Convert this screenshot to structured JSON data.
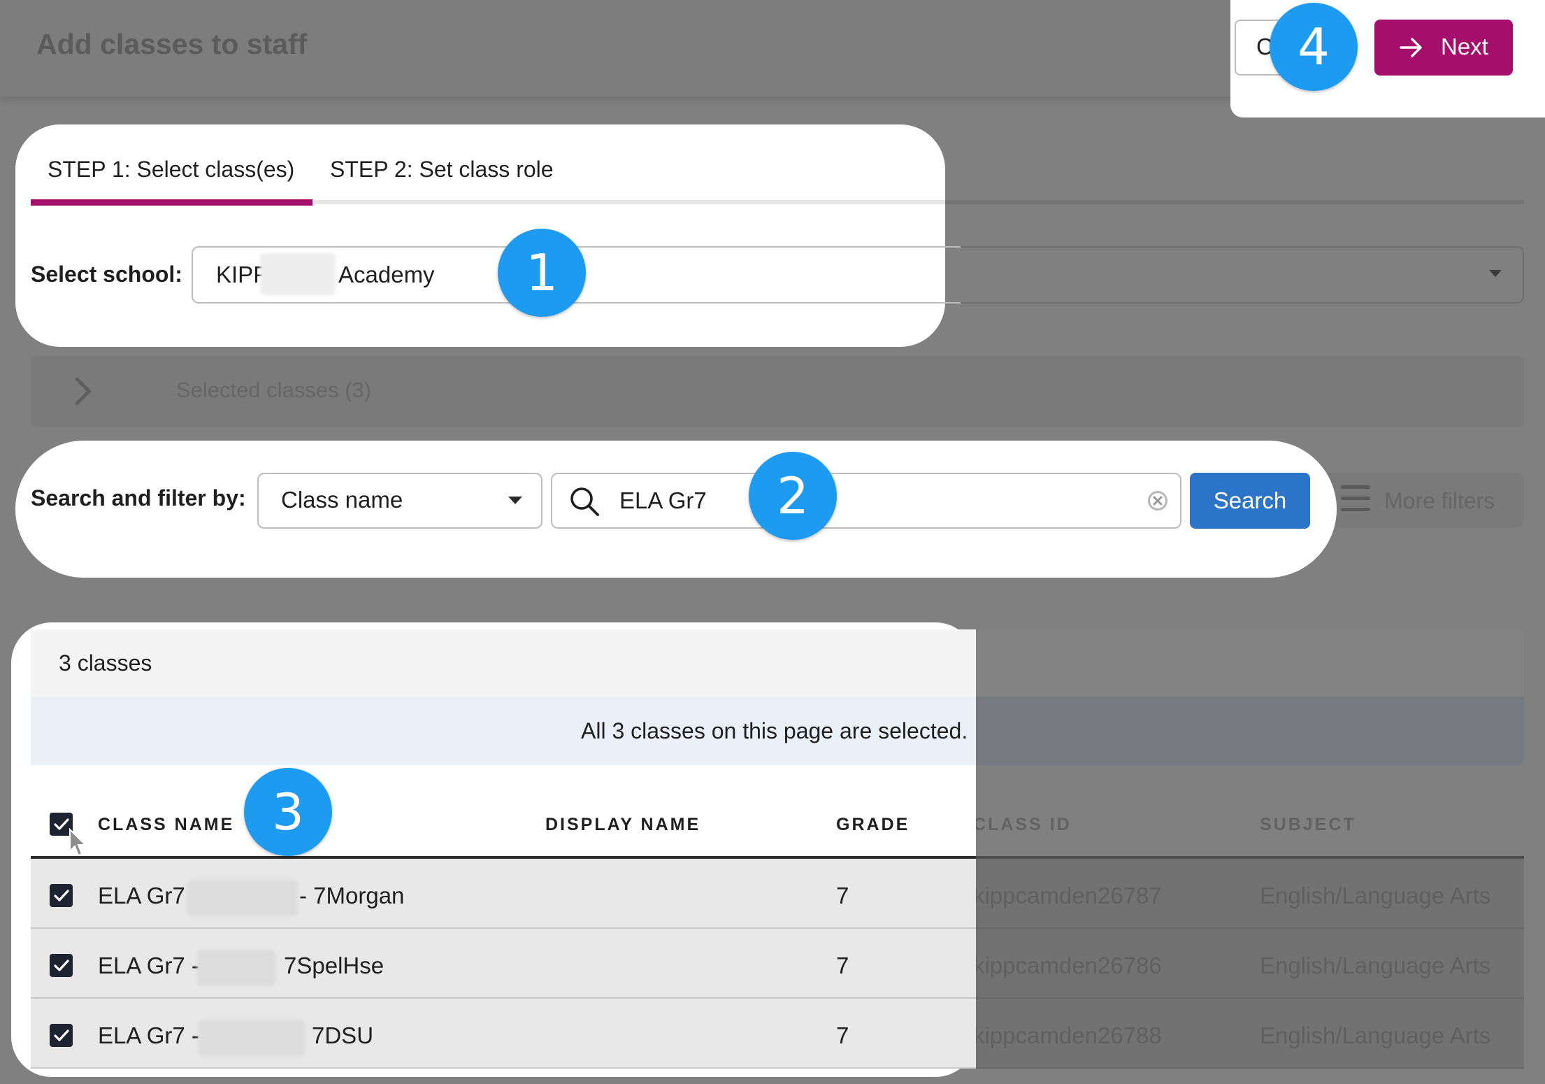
{
  "page": {
    "title": "Add classes to staff"
  },
  "actions": {
    "cancel_label": "C",
    "next_label": "Next"
  },
  "tabs": [
    {
      "label": "STEP 1: Select class(es)",
      "active": true
    },
    {
      "label": "STEP 2: Set class role",
      "active": false
    }
  ],
  "school": {
    "label": "Select school:",
    "value_start": "KIPP",
    "value_end": "Academy"
  },
  "selected_classes": {
    "label": "Selected classes (3)"
  },
  "filter": {
    "label": "Search and filter by:",
    "field": "Class name",
    "query": "ELA Gr7",
    "search_label": "Search",
    "more_filters_label": "More filters"
  },
  "results": {
    "count_text": "3 classes",
    "selection_text": "All 3 classes on this page are selected."
  },
  "table": {
    "headers": {
      "class_name": "CLASS NAME",
      "display_name": "DISPLAY NAME",
      "grade": "GRADE",
      "class_id": "CLASS ID",
      "subject": "SUBJECT"
    },
    "rows": [
      {
        "class_prefix": "ELA Gr7",
        "class_suffix": "- 7Morgan",
        "display_name": "",
        "grade": "7",
        "class_id": "kippcamden26787",
        "subject": "English/Language Arts",
        "checked": true
      },
      {
        "class_prefix": "ELA Gr7 -",
        "class_suffix": "7SpelHse",
        "display_name": "",
        "grade": "7",
        "class_id": "kippcamden26786",
        "subject": "English/Language Arts",
        "checked": true
      },
      {
        "class_prefix": "ELA Gr7 -",
        "class_suffix": "7DSU",
        "display_name": "",
        "grade": "7",
        "class_id": "kippcamden26788",
        "subject": "English/Language Arts",
        "checked": true
      }
    ]
  },
  "callouts": [
    "1",
    "2",
    "3",
    "4"
  ],
  "colors": {
    "accent": "#a50e6a",
    "search_button": "#2c74c9",
    "callout": "#1d9bf0"
  }
}
